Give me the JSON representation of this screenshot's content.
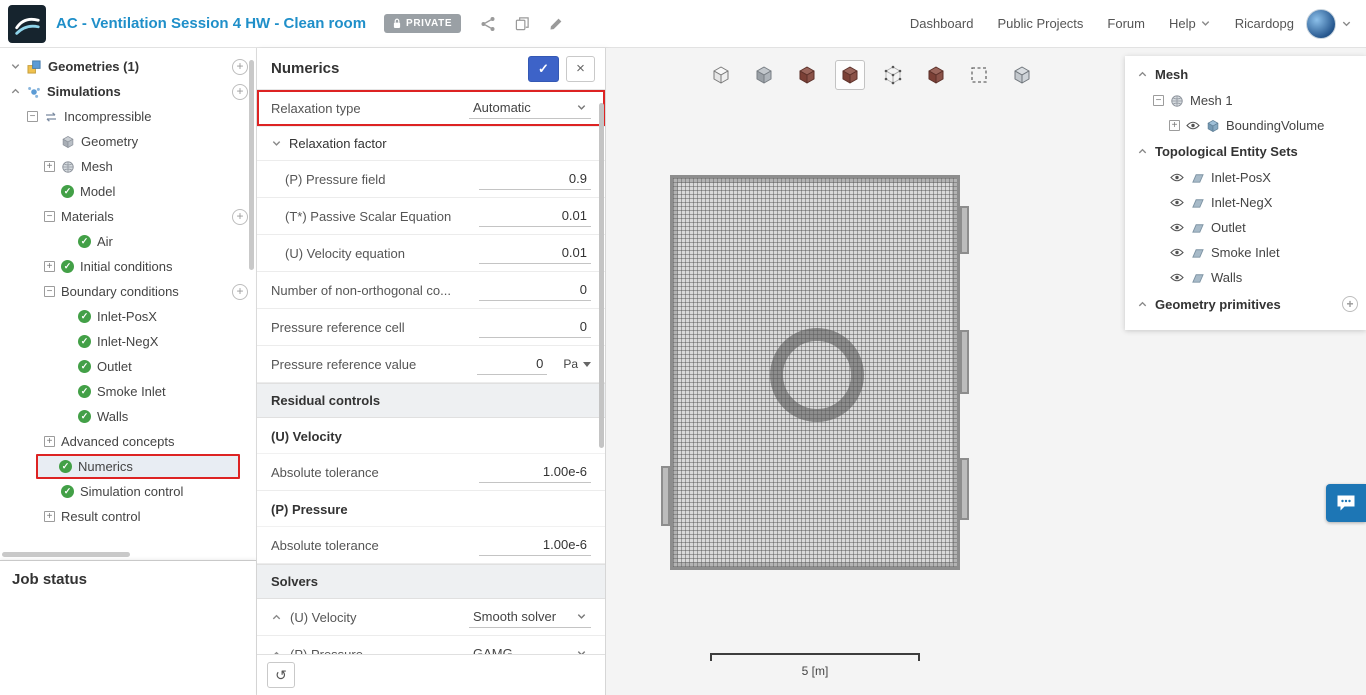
{
  "topbar": {
    "title": "AC - Ventilation Session 4 HW - Clean room",
    "private_badge": "PRIVATE",
    "nav_items": [
      "Dashboard",
      "Public Projects",
      "Forum",
      "Help"
    ],
    "username": "Ricardopg"
  },
  "left_panel": {
    "job_status_label": "Job status",
    "tree": [
      {
        "label": "Geometries (1)",
        "depth": 0,
        "expander": "chevron-down",
        "icon": "geometry-set",
        "add": true,
        "top": true
      },
      {
        "label": "Simulations",
        "depth": 0,
        "expander": "chevron-up",
        "icon": "simulation",
        "add": true,
        "top": true
      },
      {
        "label": "Incompressible",
        "depth": 1,
        "expander": "minus",
        "icon": "incompressible"
      },
      {
        "label": "Geometry",
        "depth": 2,
        "icon": "geometry"
      },
      {
        "label": "Mesh",
        "depth": 2,
        "expander": "plus",
        "icon": "mesh"
      },
      {
        "label": "Model",
        "depth": 2,
        "icon": "check"
      },
      {
        "label": "Materials",
        "depth": 2,
        "expander": "minus",
        "add": true
      },
      {
        "label": "Air",
        "depth": 3,
        "icon": "check"
      },
      {
        "label": "Initial conditions",
        "depth": 2,
        "expander": "plus",
        "icon": "check"
      },
      {
        "label": "Boundary conditions",
        "depth": 2,
        "expander": "minus",
        "add": true
      },
      {
        "label": "Inlet-PosX",
        "depth": 3,
        "icon": "check"
      },
      {
        "label": "Inlet-NegX",
        "depth": 3,
        "icon": "check"
      },
      {
        "label": "Outlet",
        "depth": 3,
        "icon": "check"
      },
      {
        "label": "Smoke Inlet",
        "depth": 3,
        "icon": "check"
      },
      {
        "label": "Walls",
        "depth": 3,
        "icon": "check"
      },
      {
        "label": "Advanced concepts",
        "depth": 2,
        "expander": "plus"
      },
      {
        "label": "Numerics",
        "depth": 2,
        "icon": "check",
        "selected": true
      },
      {
        "label": "Simulation control",
        "depth": 2,
        "icon": "check"
      },
      {
        "label": "Result control",
        "depth": 2,
        "expander": "plus"
      }
    ]
  },
  "settings_panel": {
    "title": "Numerics",
    "apply_glyph": "✓",
    "close_glyph": "×",
    "undo_glyph": "↺",
    "rows": [
      {
        "type": "select",
        "label": "Relaxation type",
        "value": "Automatic",
        "highlighted": true
      },
      {
        "type": "group",
        "label": "Relaxation factor"
      },
      {
        "type": "input",
        "label": "(P) Pressure field",
        "value": "0.9",
        "indent": true
      },
      {
        "type": "input",
        "label": "(T*) Passive Scalar Equation",
        "value": "0.01",
        "indent": true
      },
      {
        "type": "input",
        "label": "(U) Velocity equation",
        "value": "0.01",
        "indent": true
      },
      {
        "type": "input",
        "label": "Number of non-orthogonal co...",
        "value": "0"
      },
      {
        "type": "input",
        "label": "Pressure reference cell",
        "value": "0"
      },
      {
        "type": "input-unit",
        "label": "Pressure reference value",
        "value": "0",
        "unit": "Pa"
      },
      {
        "type": "section",
        "label": "Residual controls"
      },
      {
        "type": "subheader",
        "label": "(U) Velocity"
      },
      {
        "type": "input",
        "label": "Absolute tolerance",
        "value": "1.00e-6"
      },
      {
        "type": "subheader",
        "label": "(P) Pressure"
      },
      {
        "type": "input",
        "label": "Absolute tolerance",
        "value": "1.00e-6"
      },
      {
        "type": "section",
        "label": "Solvers"
      },
      {
        "type": "select-group",
        "label": "(U) Velocity",
        "value": "Smooth solver"
      },
      {
        "type": "select-group",
        "label": "(P) Pressure",
        "value": "GAMG"
      }
    ]
  },
  "viewport": {
    "toolbar": [
      {
        "name": "visibility-cube-icon",
        "style": "outline"
      },
      {
        "name": "geometry-surfaces-icon",
        "style": "solid-gray"
      },
      {
        "name": "volume-mesh-view-icon",
        "style": "solid-dark"
      },
      {
        "name": "surface-mesh-view-icon",
        "style": "solid-dark",
        "selected": true
      },
      {
        "name": "mesh-nodes-icon",
        "style": "dotted"
      },
      {
        "name": "mesh-clip-icon",
        "style": "solid-dark"
      },
      {
        "name": "box-select-icon",
        "style": "dashed"
      },
      {
        "name": "mesh-quality-icon",
        "style": "outline-gray"
      }
    ],
    "scale_label": "5 [m]"
  },
  "right_panel": {
    "sections": [
      {
        "header": "Mesh",
        "items": [
          {
            "label": "Mesh 1",
            "depth": 1,
            "expander": "minus",
            "icon": "mesh"
          },
          {
            "label": "BoundingVolume",
            "depth": 2,
            "expander": "plus",
            "eye": true,
            "icon": "solid"
          }
        ]
      },
      {
        "header": "Topological Entity Sets",
        "items": [
          {
            "label": "Inlet-PosX",
            "depth": 1,
            "eye": true,
            "icon": "surface"
          },
          {
            "label": "Inlet-NegX",
            "depth": 1,
            "eye": true,
            "icon": "surface"
          },
          {
            "label": "Outlet",
            "depth": 1,
            "eye": true,
            "icon": "surface"
          },
          {
            "label": "Smoke Inlet",
            "depth": 1,
            "eye": true,
            "icon": "surface"
          },
          {
            "label": "Walls",
            "depth": 1,
            "eye": true,
            "icon": "surface"
          }
        ]
      },
      {
        "header": "Geometry primitives",
        "add": true,
        "items": []
      }
    ]
  },
  "colors": {
    "title_blue": "#1f8fc9",
    "accent_blue": "#3d63c8",
    "highlight_red": "#dd2323",
    "check_green": "#43a047",
    "chat_blue": "#1d76b5"
  }
}
